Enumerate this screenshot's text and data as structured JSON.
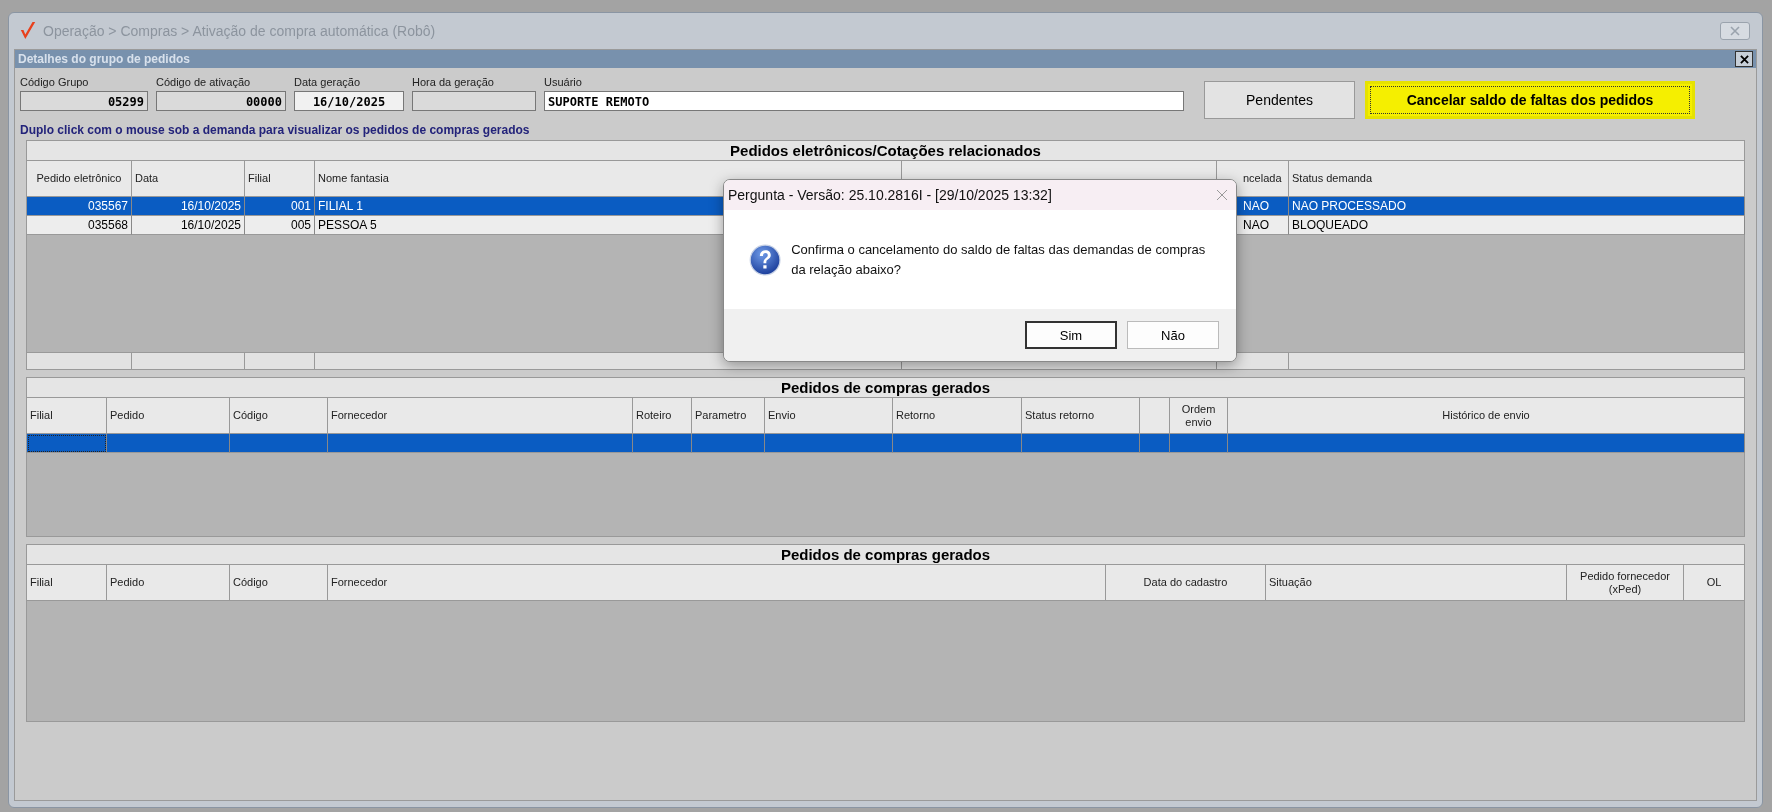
{
  "window": {
    "title": "Operação > Compras > Ativação de compra automática (Robô)"
  },
  "panel": {
    "title": "Detalhes do grupo de pedidos"
  },
  "fields": [
    {
      "label": "Código Grupo",
      "value": "05299"
    },
    {
      "label": "Código de ativação",
      "value": "00000"
    },
    {
      "label": "Data geração",
      "value": "16/10/2025"
    },
    {
      "label": "Hora da geração"
    },
    {
      "label": "Usuário",
      "value": "SUPORTE REMOTO"
    }
  ],
  "buttons": [
    {
      "label": "Pendentes",
      "kind": "normal"
    },
    {
      "label": "Cancelar saldo de faltas dos pedidos",
      "kind": "highlighted"
    }
  ],
  "hint": "Duplo click com o mouse sob a demanda para visualizar os pedidos de compras gerados",
  "tables": [
    {
      "title": "Pedidos eletrônicos/Cotações relacionados",
      "columns": [
        {
          "label": "Pedido eletrônico"
        },
        {
          "label": "Data"
        },
        {
          "label": "Filial"
        },
        {
          "label": "Nome fantasia"
        },
        {},
        {
          "label": "ncelada"
        },
        {
          "label": "Status demanda"
        }
      ],
      "rows": [
        {
          "selected": true,
          "cells": [
            "035567",
            "16/10/2025",
            "001",
            "FILIAL 1",
            null,
            "NAO",
            "NAO PROCESSADO"
          ]
        },
        {
          "selected": false,
          "cells": [
            "035568",
            "16/10/2025",
            "005",
            "PESSOA 5",
            null,
            "NAO",
            "BLOQUEADO"
          ]
        }
      ]
    },
    {
      "title": "Pedidos de compras gerados",
      "columns": [
        {
          "label": "Filial"
        },
        {
          "label": "Pedido"
        },
        {
          "label": "Código"
        },
        {
          "label": "Fornecedor"
        },
        {
          "label": "Roteiro"
        },
        {
          "label": "Parametro"
        },
        {
          "label": "Envio"
        },
        {
          "label": "Retorno"
        },
        {
          "label": "Status retorno"
        },
        {},
        {
          "label": "Ordem envio"
        },
        {
          "label": "Histórico de envio"
        }
      ],
      "rows": [
        {
          "selected": true
        }
      ]
    },
    {
      "title": "Pedidos de compras gerados",
      "columns": [
        {
          "label": "Filial"
        },
        {
          "label": "Pedido"
        },
        {
          "label": "Código"
        },
        {
          "label": "Fornecedor"
        },
        {
          "label": "Data do cadastro"
        },
        {
          "label": "Situação"
        },
        {
          "label": "Pedido fornecedor (xPed)"
        },
        {
          "label": "OL"
        }
      ]
    }
  ],
  "dialog": {
    "title": "Pergunta - Versão: 25.10.2816I - [29/10/2025 13:32]",
    "message": "Confirma o cancelamento do saldo de faltas das demandas de compras da relação abaixo?",
    "buttons": [
      "Sim",
      "Não"
    ]
  }
}
